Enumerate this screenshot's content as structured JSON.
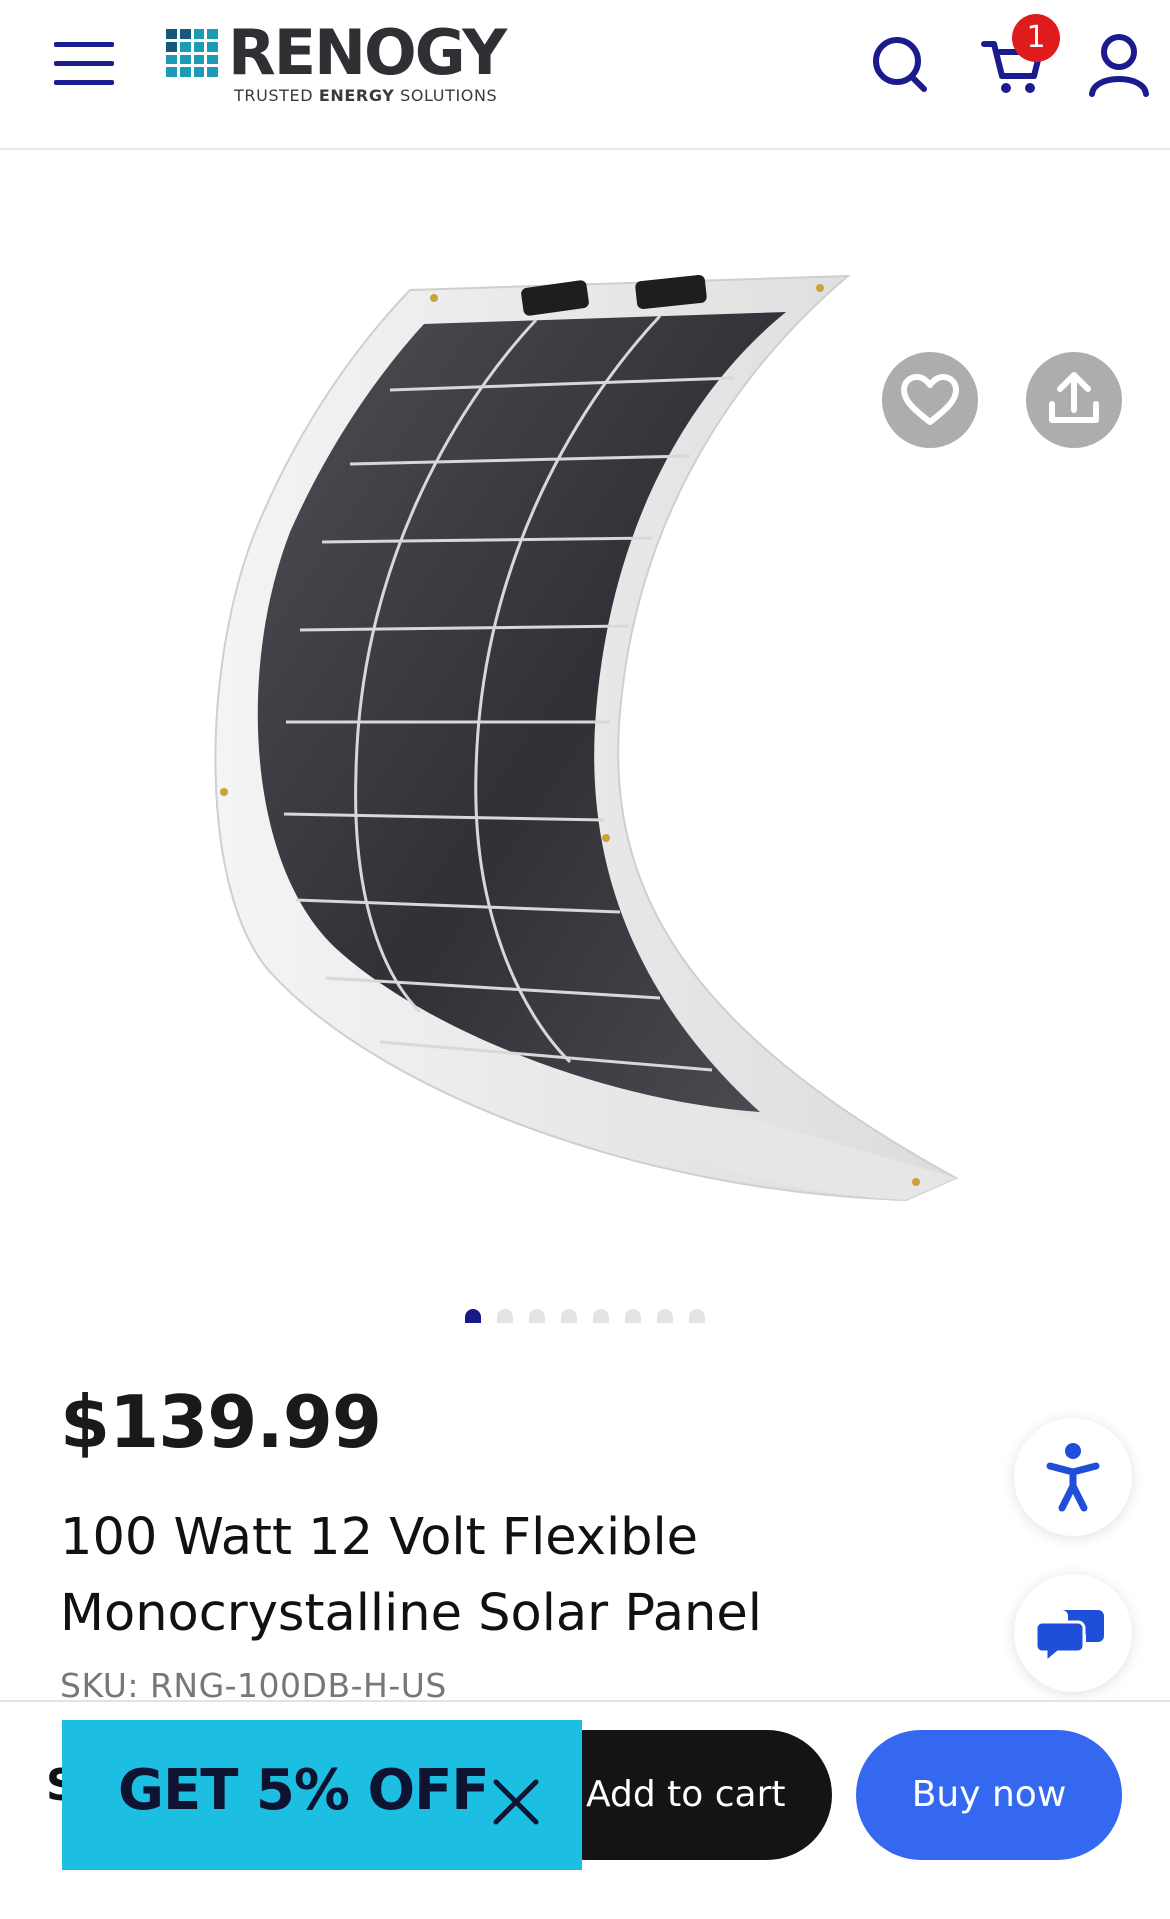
{
  "header": {
    "brand_name": "RENOGY",
    "brand_tagline_pre": "TRUSTED ",
    "brand_tagline_bold": "ENERGY",
    "brand_tagline_post": " SOLUTIONS",
    "cart_count": "1",
    "accent_color": "#1b1a8f",
    "badge_color": "#e01b1b",
    "icons": [
      "menu-icon",
      "search-icon",
      "cart-icon",
      "account-icon"
    ]
  },
  "gallery": {
    "image_subject": "flexible solar panel",
    "slide_count": 8,
    "active_slide": 1,
    "actions": [
      "heart-icon",
      "share-icon"
    ]
  },
  "product": {
    "price": "$139.99",
    "title": "100 Watt 12 Volt Flexible Monocrystalline Solar Panel",
    "sku": "SKU: RNG-100DB-H-US"
  },
  "floating": {
    "icons": [
      "accessibility-icon",
      "chat-icon"
    ]
  },
  "actions": {
    "add_to_cart": "Add to cart",
    "buy_now": "Buy now",
    "buy_now_color": "#3468f0",
    "hidden_leading_char": "S"
  },
  "promo": {
    "label": "GET 5% OFF",
    "color": "#1cbfe2"
  }
}
